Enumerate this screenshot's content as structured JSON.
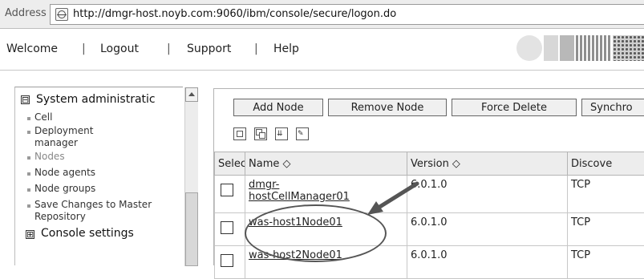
{
  "address_bar": {
    "label": "Address",
    "url": "http://dmgr-host.noyb.com:9060/ibm/console/secure/logon.do"
  },
  "top_nav": {
    "items": [
      "Welcome",
      "Logout",
      "Support",
      "Help"
    ],
    "separator": "|"
  },
  "sidebar": {
    "section_toggle": "⊟",
    "section_title": "System administratic",
    "items": [
      "Cell",
      "Deployment manager",
      "Nodes",
      "Node agents",
      "Node groups",
      "Save Changes to Master Repository"
    ],
    "items_dimmed": [
      "Nodes"
    ],
    "footer_toggle": "⊞",
    "footer_title": "Console settings"
  },
  "toolbar": {
    "buttons": [
      "Add Node",
      "Remove Node",
      "Force Delete",
      "Synchro"
    ],
    "icons": [
      "select-all-icon",
      "deselect-all-icon",
      "expand-filter-icon",
      "clear-filter-icon"
    ]
  },
  "table": {
    "columns": [
      "Select",
      "Name ◇",
      "Version ◇",
      "Discove"
    ],
    "rows": [
      {
        "name": "dmgr-hostCellManager01",
        "version": "6.0.1.0",
        "discovery": "TCP"
      },
      {
        "name": "was-host1Node01",
        "version": "6.0.1.0",
        "discovery": "TCP"
      },
      {
        "name": "was-host2Node01",
        "version": "6.0.1.0",
        "discovery": "TCP"
      }
    ],
    "row1_name_line1": "dmgr-",
    "row1_name_line2": "hostCellManager01"
  },
  "colors": {
    "address_bar_bg": "#ededed",
    "table_header_bg": "#ededed",
    "annotation": "#555555"
  }
}
